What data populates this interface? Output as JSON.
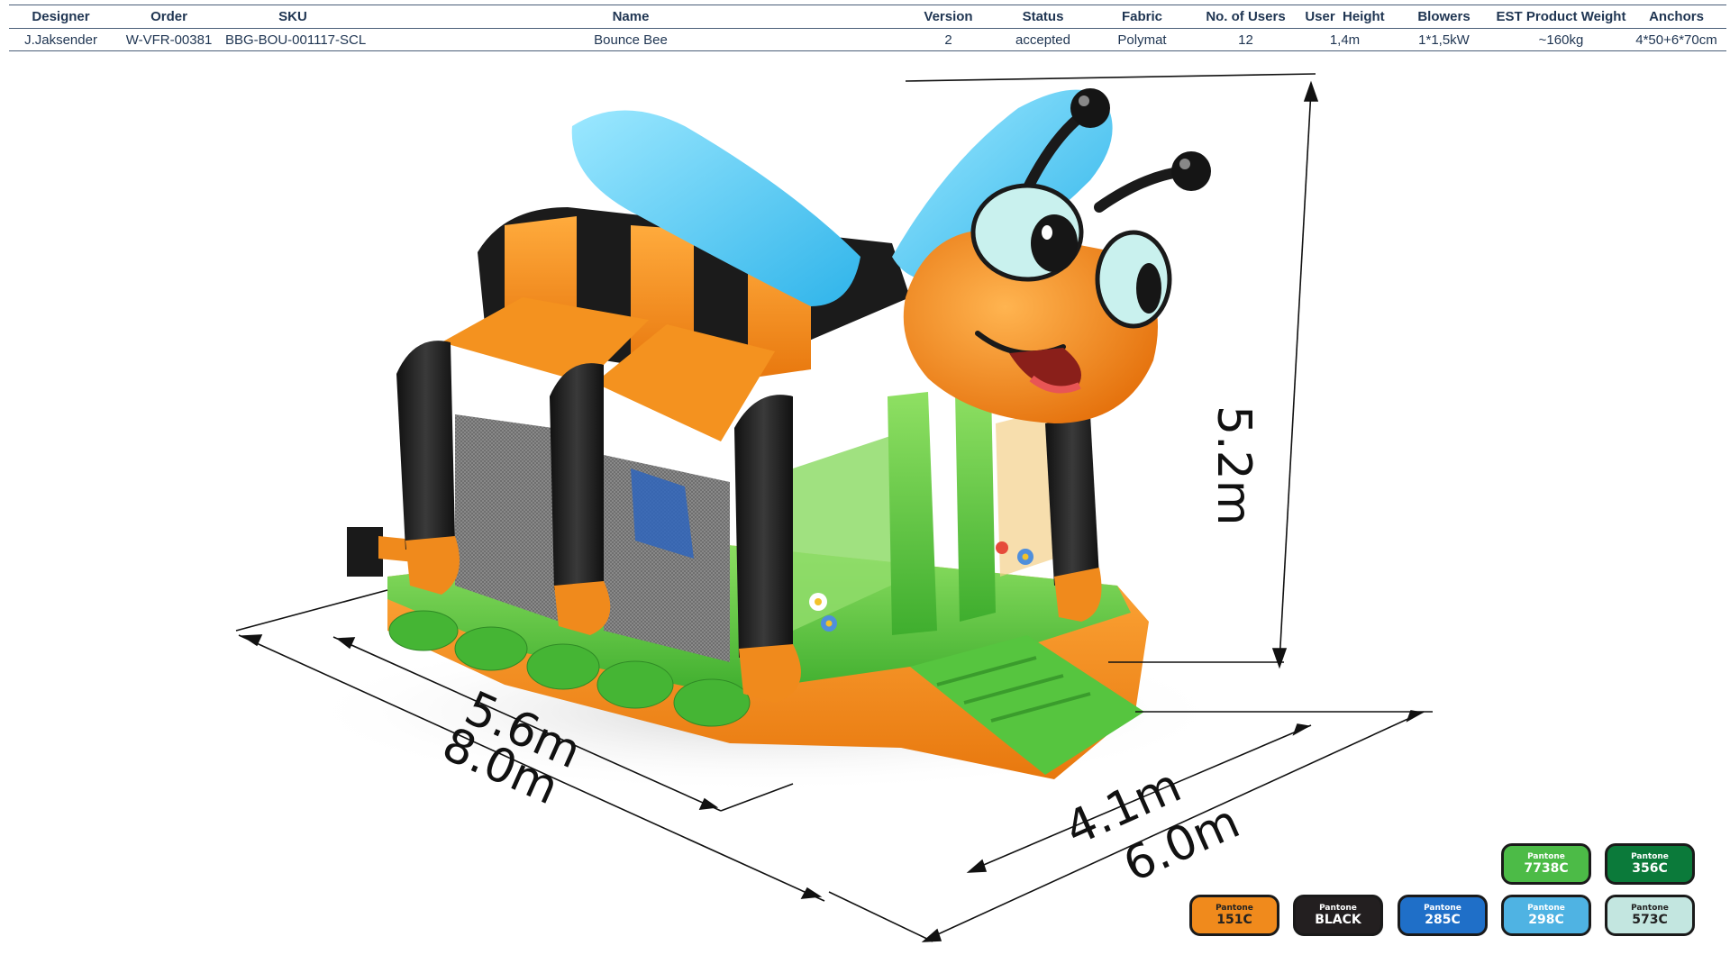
{
  "table": {
    "headers": [
      "Designer",
      "Order",
      "SKU",
      "Name",
      "Version",
      "Status",
      "Fabric",
      "No. of Users",
      "User  Height",
      "Blowers",
      "EST Product Weight",
      "Anchors"
    ],
    "row": [
      "J.Jaksender",
      "W-VFR-00381",
      "BBG-BOU-001117-SCL",
      "Bounce Bee",
      "2",
      "accepted",
      "Polymat",
      "12",
      "1,4m",
      "1*1,5kW",
      "~160kg",
      "4*50+6*70cm"
    ]
  },
  "dimensions": {
    "height": "5.2m",
    "length_inner": "5.6m",
    "length_outer": "8.0m",
    "width_inner": "4.1m",
    "width_outer": "6.0m"
  },
  "swatches": [
    {
      "brand": "Pantone",
      "code": "7738C",
      "color": "#4cbb47"
    },
    {
      "brand": "Pantone",
      "code": "356C",
      "color": "#0b7a3a"
    },
    {
      "brand": "Pantone",
      "code": "151C",
      "color": "#f08a1c"
    },
    {
      "brand": "Pantone",
      "code": "BLACK",
      "color": "#231f20"
    },
    {
      "brand": "Pantone",
      "code": "285C",
      "color": "#1f6fc8"
    },
    {
      "brand": "Pantone",
      "code": "298C",
      "color": "#4fb3e3"
    },
    {
      "brand": "Pantone",
      "code": "573C",
      "color": "#c3e6e0"
    }
  ]
}
